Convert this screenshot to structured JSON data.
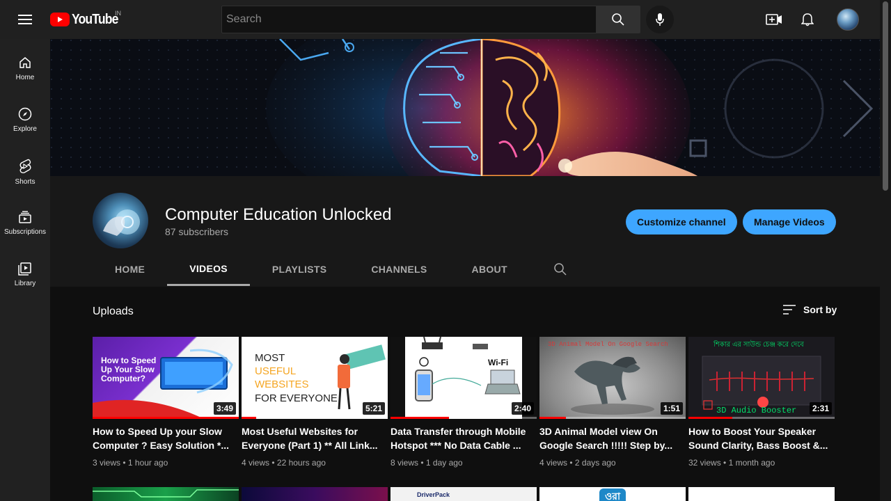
{
  "header": {
    "logo_text": "YouTube",
    "country_code": "IN",
    "search_placeholder": "Search"
  },
  "sidebar": {
    "items": [
      {
        "label": "Home",
        "icon": "home-icon"
      },
      {
        "label": "Explore",
        "icon": "compass-icon"
      },
      {
        "label": "Shorts",
        "icon": "shorts-icon"
      },
      {
        "label": "Subscriptions",
        "icon": "subscriptions-icon"
      },
      {
        "label": "Library",
        "icon": "library-icon"
      }
    ]
  },
  "channel": {
    "name": "Computer Education Unlocked",
    "subscribers": "87 subscribers",
    "customize_label": "Customize channel",
    "manage_label": "Manage Videos",
    "tabs": [
      "HOME",
      "VIDEOS",
      "PLAYLISTS",
      "CHANNELS",
      "ABOUT"
    ],
    "active_tab": "VIDEOS"
  },
  "uploads": {
    "title": "Uploads",
    "sort_label": "Sort by",
    "videos": [
      {
        "title": "How to Speed Up your Slow Computer ? Easy Solution *...",
        "views": "3 views",
        "ago": "1 hour ago",
        "duration": "3:49",
        "thumb_text": "How to Speed Up Your Slow Computer?",
        "watched": 1.0
      },
      {
        "title": "Most Useful Websites for Everyone (Part 1) ** All Link...",
        "views": "4 views",
        "ago": "22 hours ago",
        "duration": "5:21",
        "thumb_text_1": "MOST",
        "thumb_text_2": "USEFUL",
        "thumb_text_3": "WEBSITES",
        "thumb_text_4": "FOR EVERYONE",
        "watched": 0.1
      },
      {
        "title": "Data Transfer through Mobile Hotspot *** No Data Cable ...",
        "views": "8 views",
        "ago": "1 day ago",
        "duration": "2:40",
        "thumb_text": "Wi-Fi",
        "watched": 0.4
      },
      {
        "title": "3D Animal Model view On Google Search !!!!! Step by...",
        "views": "4 views",
        "ago": "2 days ago",
        "duration": "1:51",
        "thumb_text": "3D Animal Model On Google Search",
        "watched": 0.18
      },
      {
        "title": "How to Boost Your Speaker Sound Clarity, Bass Boost &...",
        "views": "32 views",
        "ago": "1 month ago",
        "duration": "2:31",
        "thumb_text_top": "শিকার এর সাউন্ড চেঞ্জ করে দেবে",
        "thumb_text_bottom": "3D Audio Booster",
        "watched": 0.3
      }
    ],
    "row2_labels": [
      "DriverPack",
      "ওরা"
    ]
  },
  "colors": {
    "accent": "#3ea6ff",
    "brand_red": "#ff0000",
    "bg": "#0f0f0f"
  }
}
